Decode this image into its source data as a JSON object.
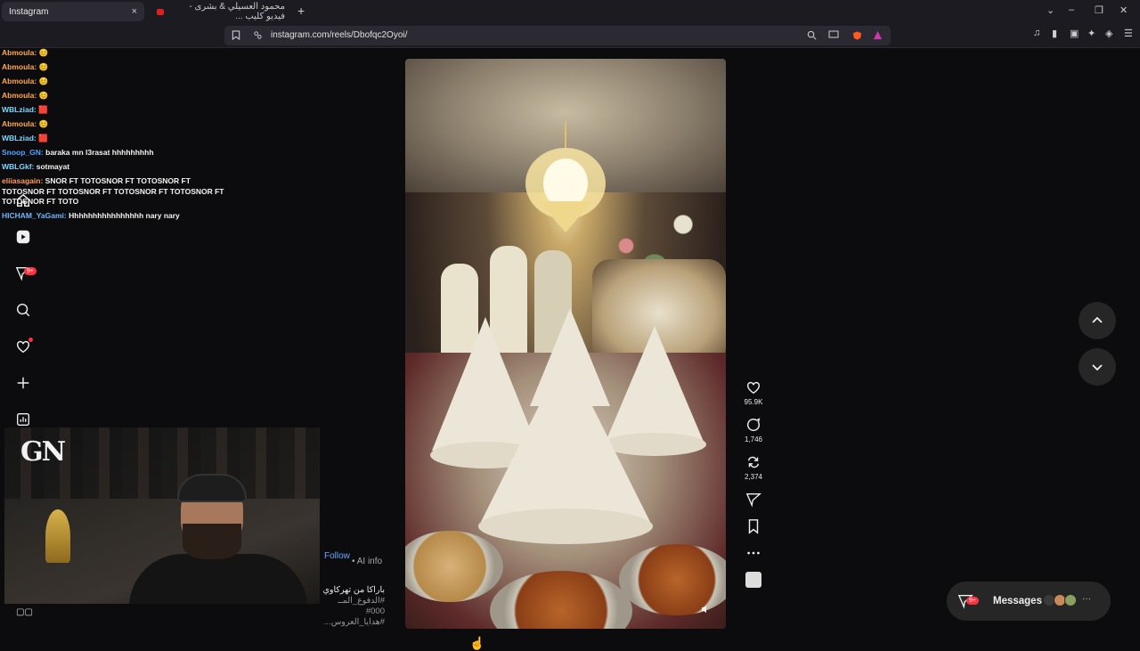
{
  "browser": {
    "tabs": [
      {
        "label": "Instagram",
        "close": "×"
      },
      {
        "label": "محمود العسيلي & بشرى - فيديو كليب ...",
        "close": ""
      }
    ],
    "new_tab": "+",
    "url": "instagram.com/reels/Dbofqc2Oyoi/",
    "window_controls": [
      "⌄",
      "–",
      "❐",
      "✕"
    ]
  },
  "chat": [
    {
      "user": "Abmoula",
      "text": "😊",
      "color": "#ffa94d"
    },
    {
      "user": "Abmoula",
      "text": "😊",
      "color": "#ffa94d"
    },
    {
      "user": "Abmoula",
      "text": "😊",
      "color": "#ffa94d"
    },
    {
      "user": "Abmoula",
      "text": "😊",
      "color": "#ffa94d"
    },
    {
      "user": "WBLziad",
      "text": "🟥",
      "color": "#7fd6ff"
    },
    {
      "user": "Abmoula",
      "text": "😊",
      "color": "#ffa94d"
    },
    {
      "user": "WBLziad",
      "text": "🟥",
      "color": "#7fd6ff"
    },
    {
      "user": "Snoop_GN",
      "text": "baraka mn l3rasat hhhhhhhhh",
      "color": "#4fa3ff"
    },
    {
      "user": "WBLGkf",
      "text": "sotmayat",
      "color": "#7fd6ff"
    },
    {
      "user": "eliiasagain",
      "text": "SNOR FT TOTOSNOR FT TOTOSNOR FT TOTOSNOR FT TOTOSNOR FT TOTOSNOR FT TOTOSNOR FT TOTOSNOR FT TOTO",
      "color": "#ff9a5c"
    },
    {
      "user": "HICHAM_YaGami",
      "text": "Hhhhhhhhhhhhhhhh nary nary",
      "color": "#6fb7ff"
    }
  ],
  "sidenav": {
    "badge": "9+"
  },
  "post": {
    "follow": "Follow",
    "ai_info": "• AI info",
    "caption_lines": [
      "باراكا من تهركاوي",
      "#الدفوع_المــ 000#",
      "#هدايا_العروس..."
    ]
  },
  "actions": {
    "likes": "95.9K",
    "comments": "1,746",
    "reposts": "2,374"
  },
  "messages": {
    "label": "Messages",
    "badge": "9+",
    "more": "···"
  },
  "colors": {
    "accent": "#ff3040",
    "link": "#6aa5ff"
  }
}
